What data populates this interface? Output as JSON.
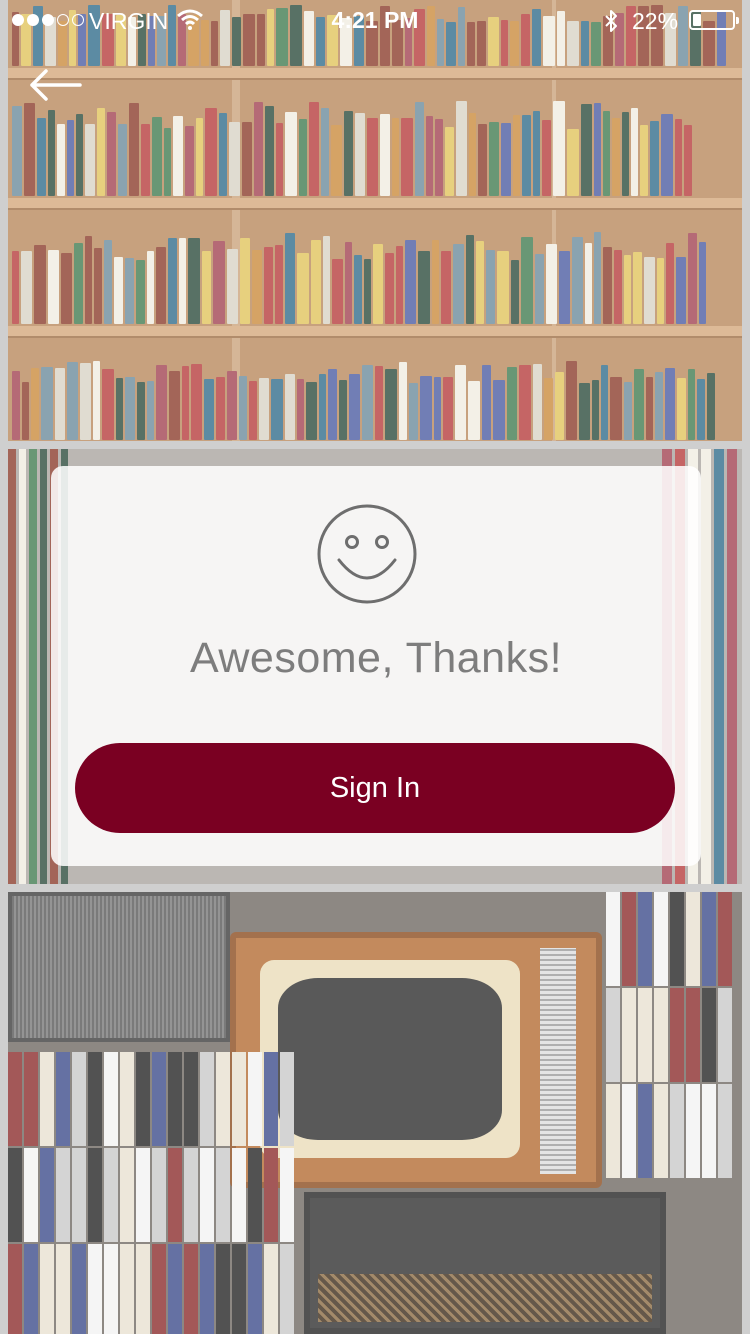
{
  "status_bar": {
    "carrier": "VIRGIN",
    "time": "4:21 PM",
    "battery_percent": "22%",
    "battery_level": 0.22,
    "signal_bars_filled": 3,
    "signal_bars_total": 5
  },
  "nav": {
    "back_icon": "arrow-left-icon"
  },
  "card": {
    "icon": "smiley-face-icon",
    "title": "Awesome, Thanks!",
    "button_label": "Sign In"
  },
  "colors": {
    "button_bg": "#7a0022",
    "title_text": "#7d7d7d",
    "card_bg": "#ffffff"
  }
}
